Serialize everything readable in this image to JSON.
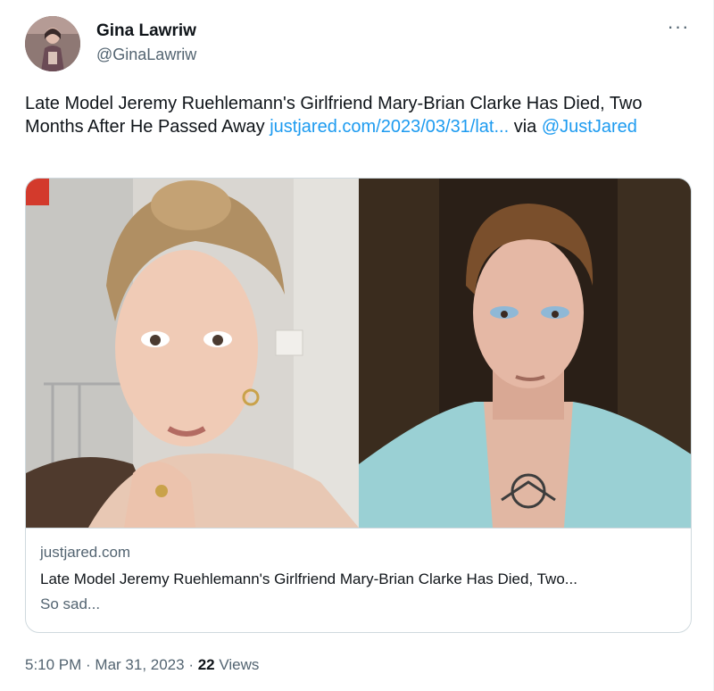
{
  "author": {
    "display_name": "Gina Lawriw",
    "handle": "@GinaLawriw",
    "more_label": "···"
  },
  "tweet": {
    "text_main": "Late Model Jeremy Ruehlemann's Girlfriend Mary-Brian Clarke Has Died, Two Months After He Passed Away ",
    "link_text": "justjared.com/2023/03/31/lat...",
    "via_text": " via ",
    "mention_text": "@JustJared"
  },
  "card": {
    "domain": "justjared.com",
    "title": "Late Model Jeremy Ruehlemann's Girlfriend Mary-Brian Clarke Has Died, Two...",
    "description": "So sad..."
  },
  "meta": {
    "time": "5:10 PM",
    "separator": " · ",
    "date": "Mar 31, 2023",
    "separator2": " · ",
    "views_count": "22",
    "views_label": " Views"
  },
  "colors": {
    "link": "#1d9bf0",
    "secondary_text": "#536471",
    "primary_text": "#0f1419",
    "border": "#cfd9de"
  },
  "icons": {
    "more": "more-dots-icon"
  }
}
